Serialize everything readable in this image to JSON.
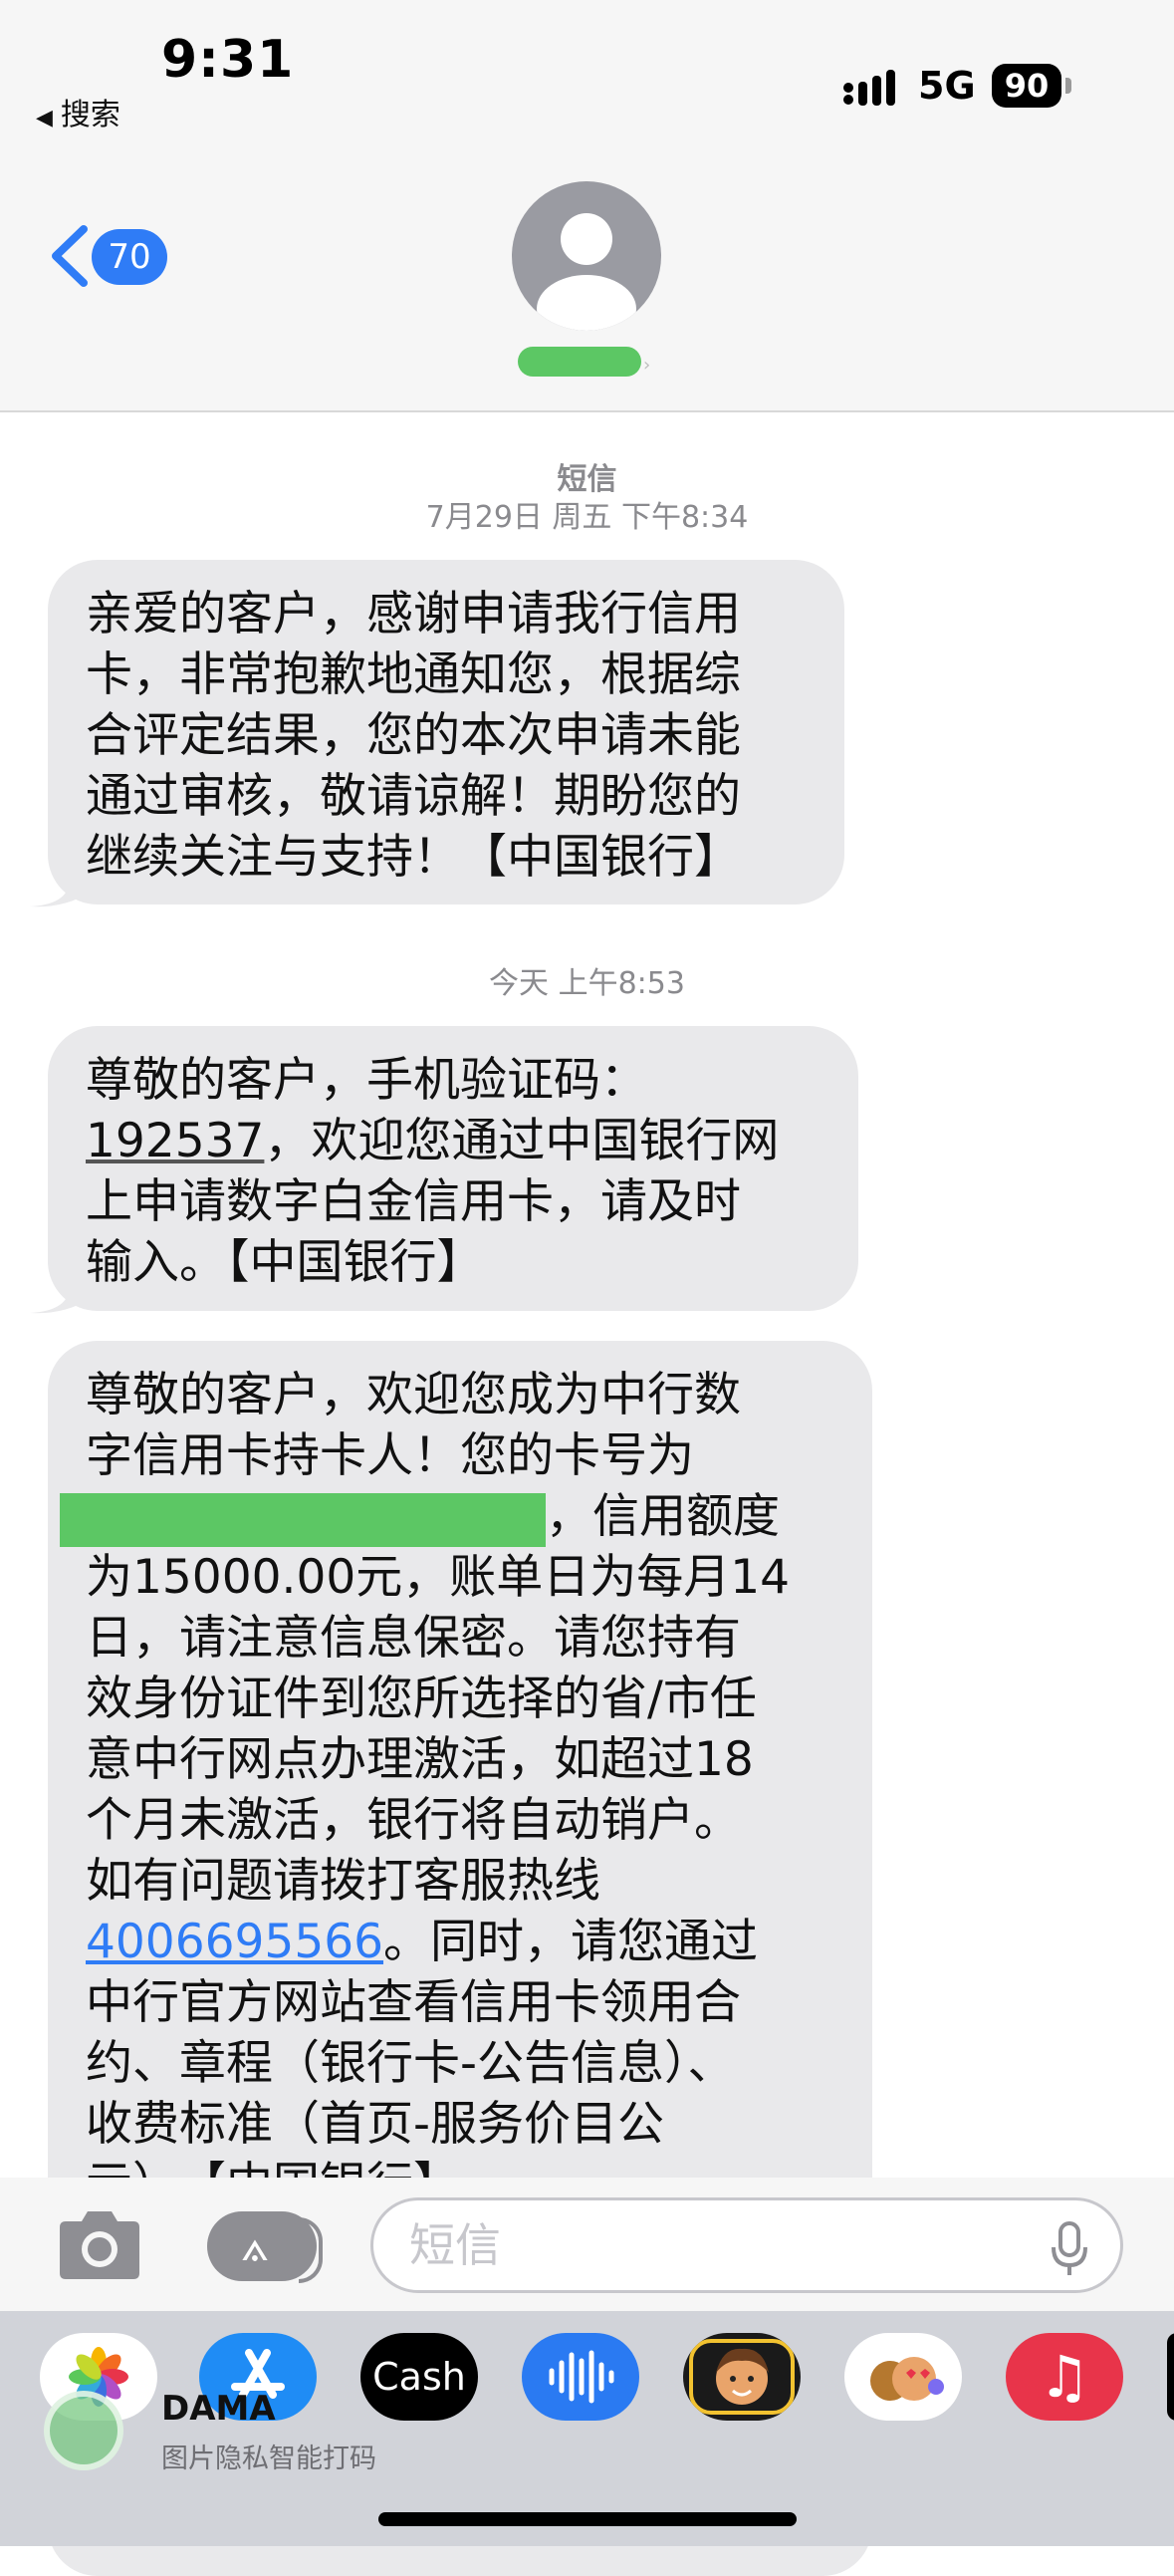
{
  "status_bar": {
    "time": "9:31",
    "back_app": "搜索",
    "network": "5G",
    "battery": "90"
  },
  "nav": {
    "unread_count": "70"
  },
  "transcript": {
    "channel_label": "短信",
    "date1": "7月29日 周五 下午8:34",
    "date2": "今天 上午8:53"
  },
  "messages": [
    {
      "lines": [
        "亲爱的客户，感谢申请我行信用",
        "卡，非常抱歉地通知您，根据综",
        "合评定结果，您的本次申请未能",
        "通过审核，敬请谅解！期盼您的",
        "继续关注与支持！【中国银行】"
      ]
    },
    {
      "line1": "尊敬的客户，手机验证码：",
      "code": "192537",
      "line2_rest": "，欢迎您通过中国银行网",
      "line3": "上申请数字白金信用卡，请及时",
      "line4": "输入。【中国银行】"
    },
    {
      "line1": "尊敬的客户，欢迎您成为中行数",
      "line2": "字信用卡持卡人！您的卡号为",
      "line3_rest": "，信用额度",
      "line4": "为15000.00元，账单日为每月14",
      "line5": "日，请注意信息保密。请您持有",
      "line6": "效身份证件到您所选择的省/市任",
      "line7": "意中行网点办理激活，如超过18",
      "line8": "个月未激活，银行将自动销户。",
      "line9": "如有问题请拨打客服热线",
      "phone": "4006695566",
      "line10_rest": "。同时，请您通过",
      "line11": "中行官方网站查看信用卡领用合",
      "line12": "约、章程（银行卡-公告信息）、",
      "line13": "收费标准（首页-服务价目公",
      "line14": "示）。【中国银行】"
    }
  ],
  "compose": {
    "placeholder": "短信"
  },
  "drawer": {
    "cash_label": "Cash",
    "watermark_title": "DAMA",
    "watermark_sub": "图片隐私智能打码"
  },
  "colors": {
    "bubble": "#e9e9eb",
    "accent": "#2f7cf6",
    "redaction": "#5cc764"
  }
}
